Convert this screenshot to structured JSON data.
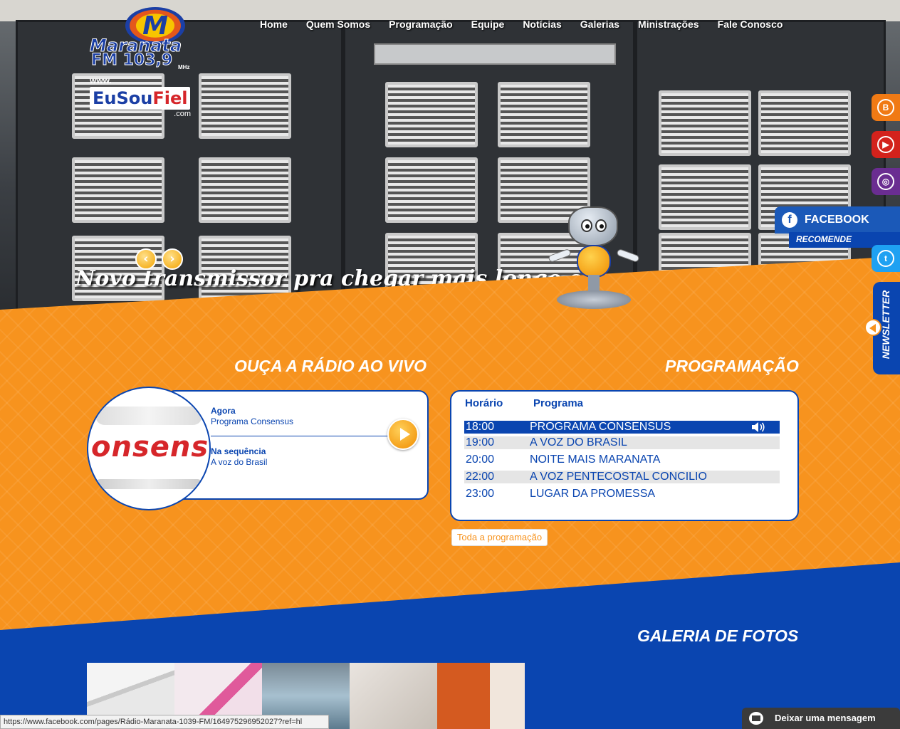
{
  "brand": {
    "logo_letter": "M",
    "logo_name": "Maranata",
    "logo_fm": "FM 103,9",
    "logo_mhz": "MHz",
    "site_www": "www.",
    "site_eu": "EuSou",
    "site_fiel": "Fiel",
    "site_com": ".com"
  },
  "nav": {
    "items": [
      "Home",
      "Quem Somos",
      "Programação",
      "Equipe",
      "Notícias",
      "Galerias",
      "Ministrações",
      "Fale Conosco"
    ]
  },
  "slider": {
    "prev": "‹",
    "next": "›",
    "caption": "Novo transmissor pra chegar mais longe e ficar mais perto de você. Ou ai"
  },
  "live": {
    "title": "OUÇA A RÁDIO AO VIVO",
    "now_label": "Agora",
    "now_value": "Programa Consensus",
    "next_label": "Na sequência",
    "next_value": "A voz do Brasil",
    "cover_text": "onsens"
  },
  "schedule": {
    "title": "PROGRAMAÇÃO",
    "col_time": "Horário",
    "col_program": "Programa",
    "rows": [
      {
        "time": "18:00",
        "program": "PROGRAMA CONSENSUS"
      },
      {
        "time": "19:00",
        "program": "A VOZ DO BRASIL"
      },
      {
        "time": "20:00",
        "program": "NOITE MAIS MARANATA"
      },
      {
        "time": "22:00",
        "program": "A VOZ PENTECOSTAL CONCILIO"
      },
      {
        "time": "23:00",
        "program": "LUGAR DA PROMESSA"
      }
    ],
    "all_button": "Toda a programação"
  },
  "gallery": {
    "title": "GALERIA DE FOTOS"
  },
  "social": {
    "facebook": "FACEBOOK",
    "facebook_sub": "RECOMENDE",
    "newsletter": "NEWSLETTER",
    "colors": {
      "blogger": "#f07a14",
      "youtube": "#d3221c",
      "instagram": "#6a2d91",
      "facebook": "#1b59b8",
      "twitter": "#1ea1f2"
    }
  },
  "statusbar": {
    "url": "https://www.facebook.com/pages/Rádio-Maranata-1039-FM/164975296952027?ref=hl"
  },
  "chat": {
    "label": "Deixar uma mensagem"
  }
}
